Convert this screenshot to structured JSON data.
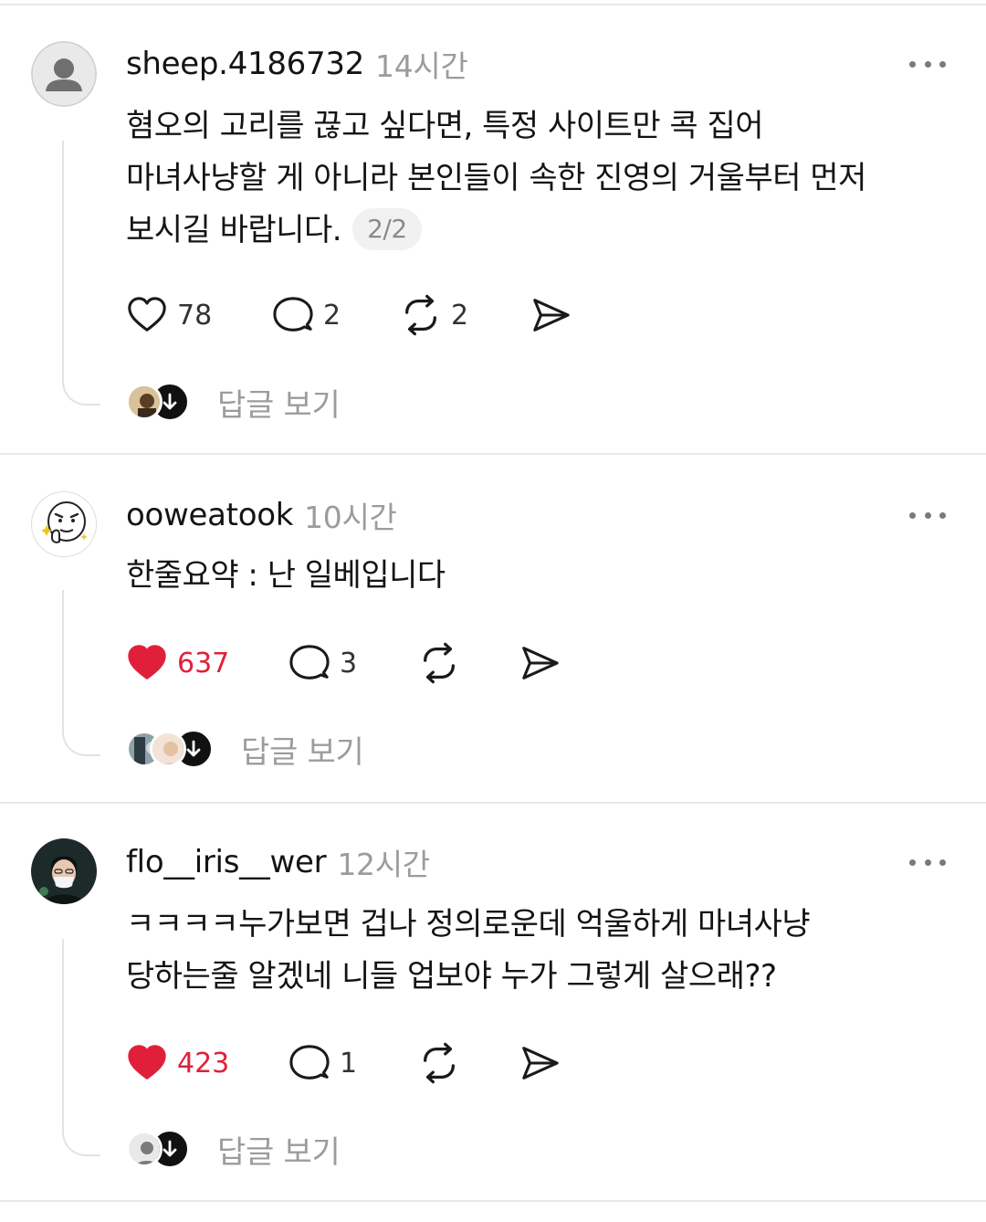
{
  "posts": [
    {
      "username": "sheep.4186732",
      "time": "14시간",
      "lines": [
        "혐오의 고리를 끊고 싶다면, 특정 사이트만 콕 집어",
        "마녀사냥할 게 아니라 본인들이 속한 진영의 거울부터 먼저",
        "보시길 바랍니다."
      ],
      "page_badge": "2/2",
      "likes": "78",
      "liked": false,
      "comments": "2",
      "reposts": "2",
      "replies_label": "답글 보기",
      "avatar_icon": "default-avatar-icon"
    },
    {
      "username": "ooweatook",
      "time": "10시간",
      "lines": [
        "한줄요약 : 난 일베입니다"
      ],
      "likes": "637",
      "liked": true,
      "comments": "3",
      "reposts": "",
      "replies_label": "답글 보기",
      "avatar_icon": "cartoon-face-avatar-icon"
    },
    {
      "username": "flo__iris__wer",
      "time": "12시간",
      "lines": [
        "ㅋㅋㅋㅋ누가보면 겁나 정의로운데 억울하게 마녀사냥",
        "당하는줄 알겠네 니들 업보야 누가 그렇게 살으래??"
      ],
      "likes": "423",
      "liked": true,
      "comments": "1",
      "reposts": "",
      "replies_label": "답글 보기",
      "avatar_icon": "masked-person-avatar-icon"
    }
  ],
  "colors": {
    "like_red": "#e0203a",
    "muted": "#9c9c9c",
    "thread_line": "#e3e3e3"
  }
}
